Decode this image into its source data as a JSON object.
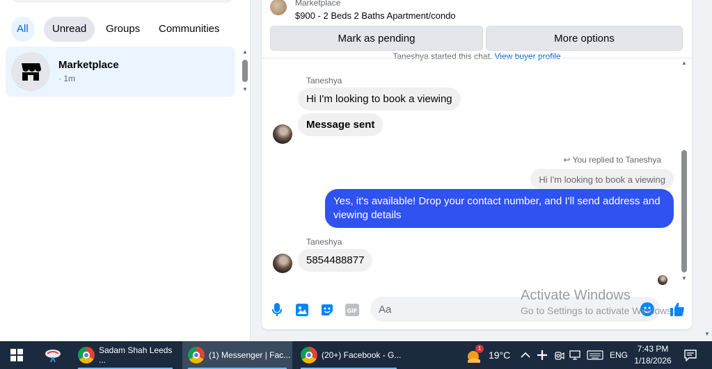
{
  "sidebar": {
    "filters": [
      "All",
      "Unread",
      "Groups",
      "Communities"
    ],
    "active_filter": "All",
    "conversation": {
      "title": "Marketplace",
      "time": "· 1m"
    }
  },
  "chat": {
    "listing": {
      "source": "Marketplace",
      "title": "$900 - 2 Beds 2 Baths Apartment/condo"
    },
    "actions": {
      "pending": "Mark as pending",
      "more": "More options"
    },
    "cut_notice": {
      "text": "Taneshya started this chat.",
      "link": "View buyer profile"
    },
    "messages": [
      {
        "sender": "Taneshya",
        "bubbles": [
          "Hi I'm looking to book a viewing",
          "Message sent"
        ]
      },
      {
        "replied_label": "You replied to Taneshya",
        "quoted": "Hi I'm looking to book a viewing",
        "text": "Yes, it's available! Drop your contact number, and I'll send address and viewing details"
      },
      {
        "sender": "Taneshya",
        "bubbles": [
          "5854488877"
        ]
      }
    ],
    "composer": {
      "placeholder": "Aa"
    },
    "accent_color": "#0084ff",
    "outgoing_color": "#2f52f0"
  },
  "watermark": {
    "title": "Activate Windows",
    "subtitle": "Go to Settings to activate Windows."
  },
  "taskbar": {
    "apps": [
      {
        "label": "Sadam Shah Leeds ..."
      },
      {
        "label": "(1) Messenger | Fac..."
      },
      {
        "label": "(20+) Facebook - G..."
      }
    ],
    "weather": {
      "temp": "19°C",
      "badge": "1"
    },
    "lang": "ENG",
    "time": "7:43 PM",
    "date": "1/18/2026"
  }
}
